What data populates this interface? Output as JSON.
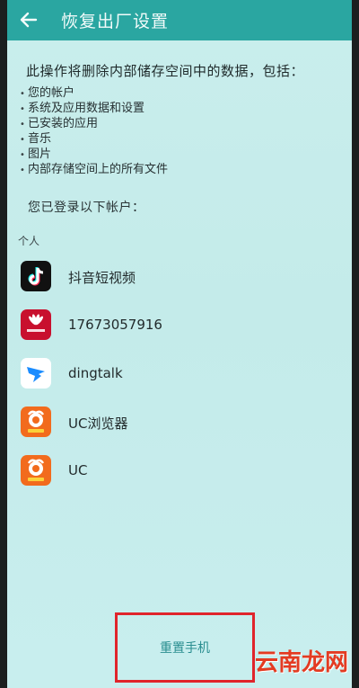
{
  "header": {
    "title": "恢复出厂设置"
  },
  "intro": "此操作将删除内部储存空间中的数据，包括：",
  "bullets": [
    "您的帐户",
    "系统及应用数据和设置",
    "已安装的应用",
    "音乐",
    "图片",
    "内部存储空间上的所有文件"
  ],
  "logged_in_label": "您已登录以下帐户：",
  "section_label": "个人",
  "accounts": [
    {
      "name": "抖音短视频",
      "icon": "tiktok-icon"
    },
    {
      "name": "17673057916",
      "icon": "huawei-icon"
    },
    {
      "name": "dingtalk",
      "icon": "dingtalk-icon"
    },
    {
      "name": "UC浏览器",
      "icon": "uc-browser-icon"
    },
    {
      "name": "UC",
      "icon": "uc-icon"
    }
  ],
  "reset_button": "重置手机",
  "watermark": "云南龙网",
  "colors": {
    "appbar": "#2aa6a1",
    "background": "#c8eeec",
    "highlight": "#e0242b",
    "button_text": "#2a8e90"
  }
}
